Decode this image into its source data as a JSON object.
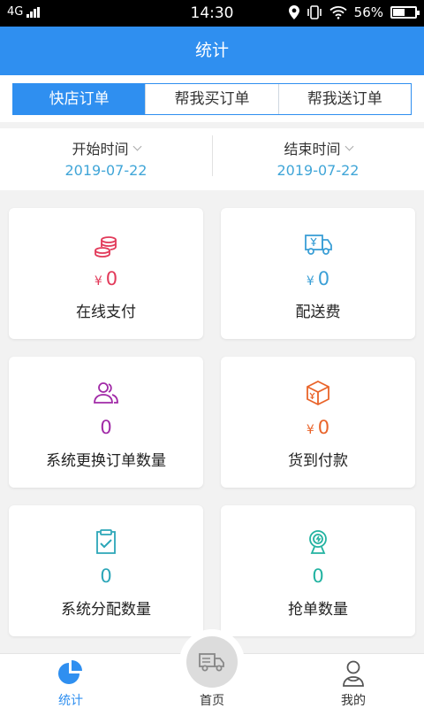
{
  "status": {
    "network": "4G",
    "time": "14:30",
    "battery": "56%",
    "battery_level": 0.56
  },
  "header": {
    "title": "统计"
  },
  "tabs": [
    {
      "label": "快店订单",
      "active": true
    },
    {
      "label": "帮我买订单",
      "active": false
    },
    {
      "label": "帮我送订单",
      "active": false
    }
  ],
  "dates": {
    "start_label": "开始时间",
    "start_value": "2019-07-22",
    "end_label": "结束时间",
    "end_value": "2019-07-22"
  },
  "cards": [
    {
      "icon": "coins-icon",
      "prefix": "¥",
      "value": "0",
      "label": "在线支付",
      "color": "#e23a5a"
    },
    {
      "icon": "delivery-truck-icon",
      "prefix": "¥",
      "value": "0",
      "label": "配送费",
      "color": "#3b9fd6"
    },
    {
      "icon": "users-swap-icon",
      "prefix": "",
      "value": "0",
      "label": "系统更换订单数量",
      "color": "#a12aa7"
    },
    {
      "icon": "cash-box-icon",
      "prefix": "¥",
      "value": "0",
      "label": "货到付款",
      "color": "#e9642a"
    },
    {
      "icon": "clipboard-check-icon",
      "prefix": "",
      "value": "0",
      "label": "系统分配数量",
      "color": "#2ba6b8"
    },
    {
      "icon": "grab-order-icon",
      "prefix": "",
      "value": "0",
      "label": "抢单数量",
      "color": "#22b3a1"
    }
  ],
  "bottom_nav": [
    {
      "label": "统计",
      "icon": "pie-chart-icon",
      "active": true
    },
    {
      "label": "首页",
      "icon": "truck-icon",
      "active": false
    },
    {
      "label": "我的",
      "icon": "profile-icon",
      "active": false
    }
  ],
  "colors": {
    "primary": "#2f8ff0",
    "date_text": "#41a6d8"
  }
}
